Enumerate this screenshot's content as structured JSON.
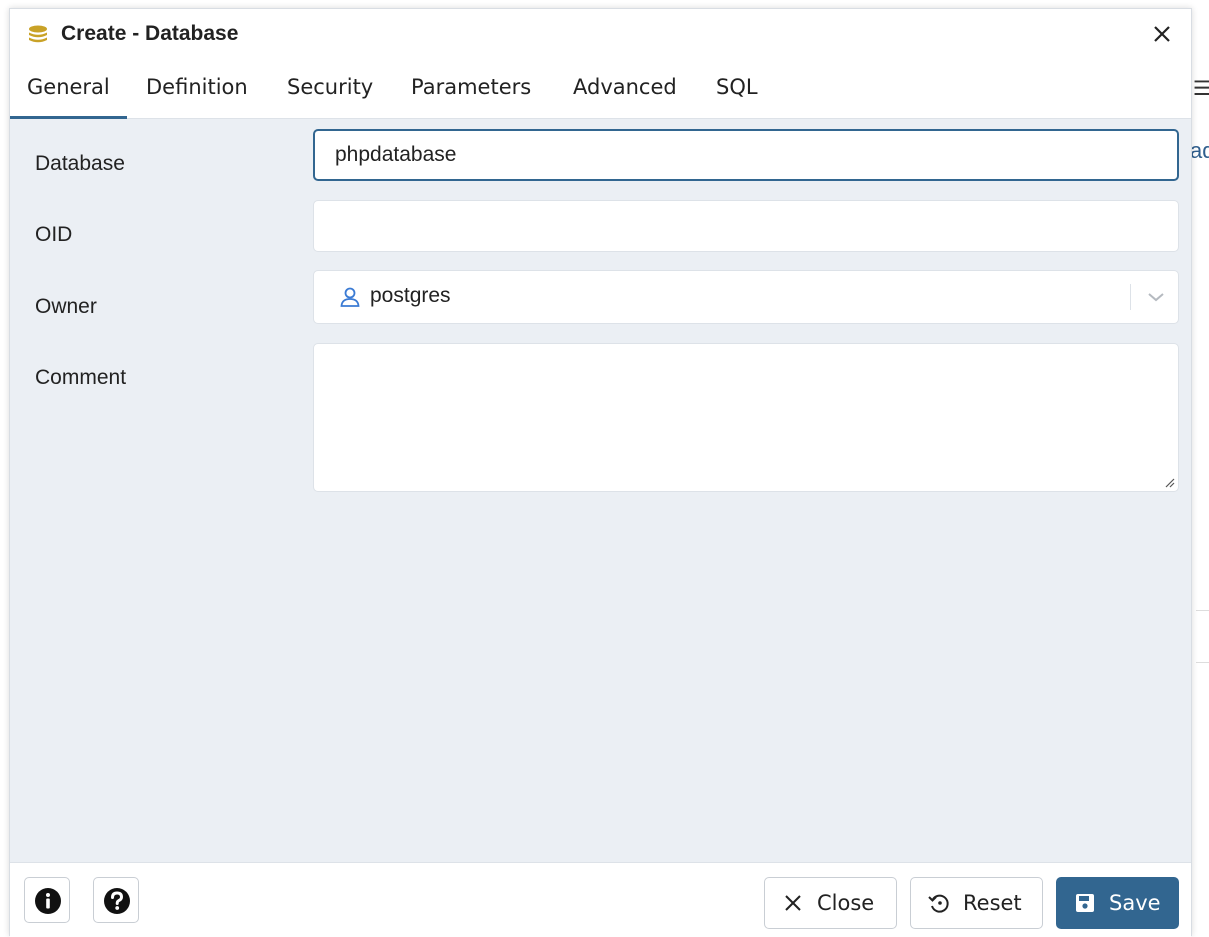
{
  "dialog": {
    "title": "Create - Database",
    "close_icon": "close-icon",
    "title_icon": "database-icon"
  },
  "tabs": [
    {
      "label": "General",
      "active": true
    },
    {
      "label": "Definition",
      "active": false
    },
    {
      "label": "Security",
      "active": false
    },
    {
      "label": "Parameters",
      "active": false
    },
    {
      "label": "Advanced",
      "active": false
    },
    {
      "label": "SQL",
      "active": false
    }
  ],
  "form": {
    "database_label": "Database",
    "database_value": "phpdatabase",
    "oid_label": "OID",
    "oid_value": "",
    "owner_label": "Owner",
    "owner_value": "postgres",
    "comment_label": "Comment",
    "comment_value": ""
  },
  "footer": {
    "info_icon": "info-icon",
    "help_icon": "help-icon",
    "close_label": "Close",
    "reset_label": "Reset",
    "save_label": "Save"
  },
  "background": {
    "right_text": "ad"
  },
  "colors": {
    "accent": "#326690",
    "body_bg": "#ebeff4",
    "database_icon": "#c9a227",
    "owner_icon": "#3b7bd4"
  }
}
